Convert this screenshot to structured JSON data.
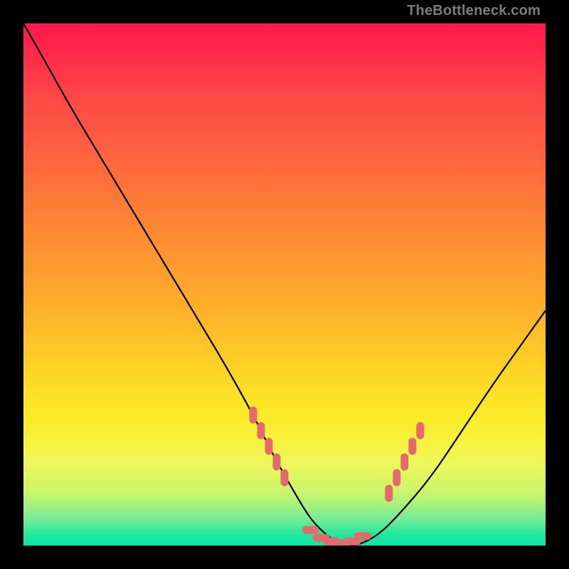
{
  "watermark": "TheBottleneck.com",
  "chart_data": {
    "type": "line",
    "title": "",
    "xlabel": "",
    "ylabel": "",
    "xlim": [
      0,
      100
    ],
    "ylim": [
      0,
      100
    ],
    "series": [
      {
        "name": "bottleneck-curve",
        "x": [
          0,
          4,
          9,
          15,
          21,
          27,
          33,
          39,
          44,
          48,
          52,
          55,
          58,
          61,
          64,
          68,
          72,
          78,
          84,
          90,
          95,
          100
        ],
        "y": [
          100,
          93,
          84,
          74,
          64,
          54,
          44,
          34,
          25,
          17,
          10,
          5,
          2,
          0,
          0,
          2,
          6,
          13,
          22,
          31,
          38,
          45
        ]
      }
    ],
    "highlights": {
      "name": "marker-band",
      "color": "#e26a6a",
      "left_cluster_x": [
        44,
        45.5,
        47,
        48.5,
        50
      ],
      "left_cluster_y": [
        25,
        22,
        19,
        16,
        13
      ],
      "bottom_cluster_x": [
        55,
        57,
        59,
        61,
        63,
        65
      ],
      "bottom_cluster_y": [
        3,
        1.5,
        0.8,
        0.5,
        0.8,
        1.8
      ],
      "right_cluster_x": [
        70,
        71.5,
        73,
        74.5,
        76
      ],
      "right_cluster_y": [
        10,
        13,
        16,
        19,
        22
      ]
    }
  }
}
